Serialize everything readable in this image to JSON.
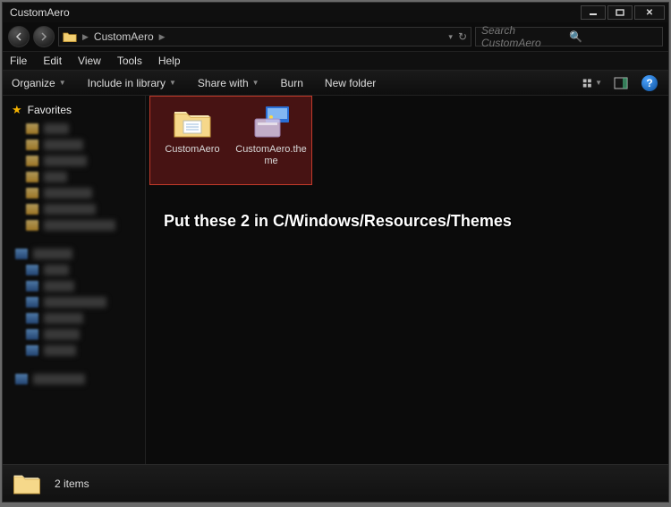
{
  "window": {
    "title": "CustomAero"
  },
  "address": {
    "path": "CustomAero",
    "refresh_title": "Refresh"
  },
  "search": {
    "placeholder": "Search CustomAero"
  },
  "menu": {
    "file": "File",
    "edit": "Edit",
    "view": "View",
    "tools": "Tools",
    "help": "Help"
  },
  "toolbar": {
    "organize": "Organize",
    "include": "Include in library",
    "share": "Share with",
    "burn": "Burn",
    "newfolder": "New folder"
  },
  "sidebar": {
    "favorites_label": "Favorites"
  },
  "files": [
    {
      "name": "CustomAero",
      "type": "folder"
    },
    {
      "name": "CustomAero.theme",
      "type": "theme"
    }
  ],
  "annotation": "Put these  2 in C/Windows/Resources/Themes",
  "status": {
    "count_label": "2 items"
  }
}
